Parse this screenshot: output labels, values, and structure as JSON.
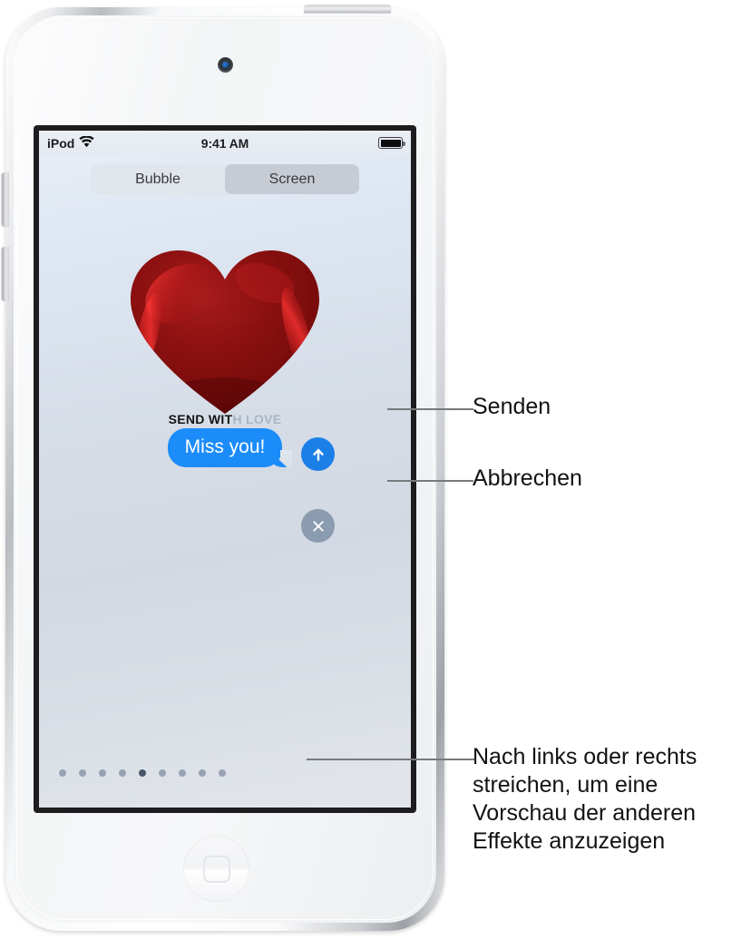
{
  "device": {
    "name": "iPod touch",
    "camera_icon": "front-camera",
    "home_button_icon": "home-button"
  },
  "status_bar": {
    "carrier": "iPod",
    "wifi_icon": "wifi-icon",
    "time": "9:41 AM",
    "battery_icon": "battery-full-icon"
  },
  "segmented_control": {
    "options": [
      {
        "label": "Bubble",
        "selected": false
      },
      {
        "label": "Screen",
        "selected": true
      }
    ]
  },
  "effect": {
    "name": "SEND WITH LOVE",
    "label": "SEND WITH LOVE",
    "balloon_icon": "heart-balloon-icon",
    "ghost_text": "Miss you!",
    "heart_color": "#9e1414"
  },
  "message": {
    "text": "Miss you!",
    "bubble_color": "#1b8cfa",
    "text_color": "#ffffff"
  },
  "buttons": {
    "send": {
      "icon": "arrow-up-icon",
      "color": "#1b7fe8"
    },
    "cancel": {
      "icon": "close-x-icon",
      "color": "#8b9bb0"
    }
  },
  "page_dots": {
    "count": 9,
    "active_index": 4,
    "inactive_color": "#97a2b3",
    "active_color": "#49566b"
  },
  "callouts": [
    {
      "id": "senden",
      "label": "Senden"
    },
    {
      "id": "abbrechen",
      "label": "Abbrechen"
    },
    {
      "id": "swipe",
      "label": "Nach links oder rechts streichen, um eine Vorschau der anderen Effekte anzuzeigen"
    }
  ]
}
